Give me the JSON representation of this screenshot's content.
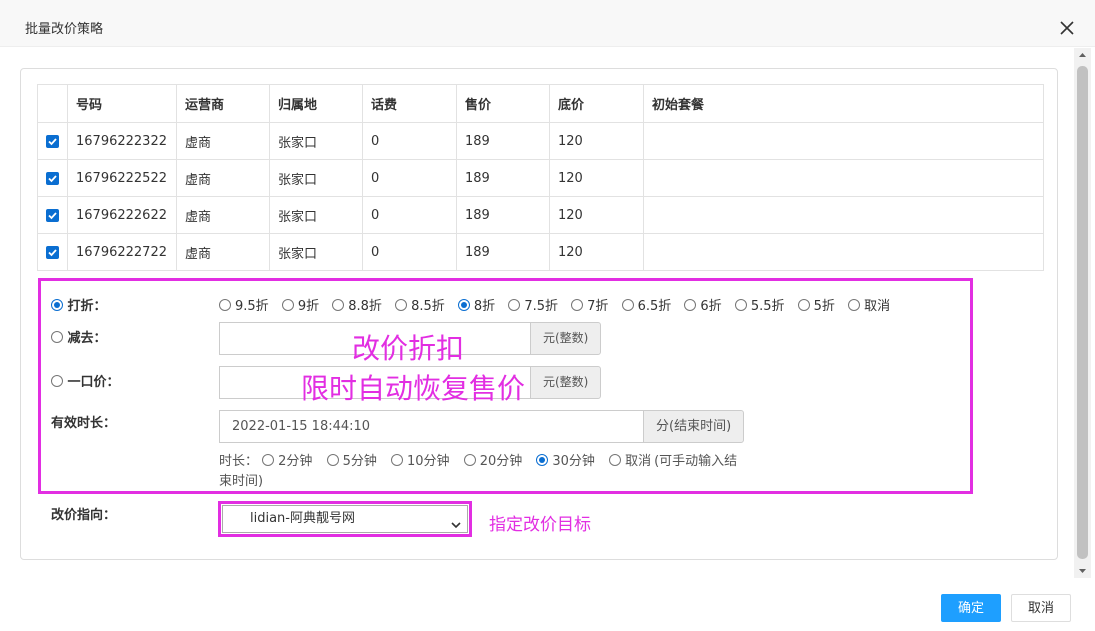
{
  "dialog": {
    "title": "批量改价策略"
  },
  "table": {
    "headers": [
      "号码",
      "运营商",
      "归属地",
      "话费",
      "售价",
      "底价",
      "初始套餐"
    ],
    "rows": [
      {
        "checked": true,
        "cells": [
          "16796222322",
          "虚商",
          "张家口",
          "0",
          "189",
          "120",
          ""
        ]
      },
      {
        "checked": true,
        "cells": [
          "16796222522",
          "虚商",
          "张家口",
          "0",
          "189",
          "120",
          ""
        ]
      },
      {
        "checked": true,
        "cells": [
          "16796222622",
          "虚商",
          "张家口",
          "0",
          "189",
          "120",
          ""
        ]
      },
      {
        "checked": true,
        "cells": [
          "16796222722",
          "虚商",
          "张家口",
          "0",
          "189",
          "120",
          ""
        ]
      }
    ]
  },
  "strategy": {
    "discount_label": "打折：",
    "discount_options": [
      "9.5折",
      "9折",
      "8.8折",
      "8.5折",
      "8折",
      "7.5折",
      "7折",
      "6.5折",
      "6折",
      "5.5折",
      "5折",
      "取消"
    ],
    "discount_selected": "8折",
    "subtract_label": "减去：",
    "subtract_value": "",
    "subtract_unit": "元(整数)",
    "fixed_label": "一口价：",
    "fixed_value": "",
    "fixed_unit": "元(整数)",
    "validity_label": "有效时长：",
    "validity_value": "2022-01-15 18:44:10",
    "validity_unit": "分(结束时间)",
    "duration_prefix": "时长：",
    "duration_options": [
      "2分钟",
      "5分钟",
      "10分钟",
      "20分钟",
      "30分钟",
      "取消"
    ],
    "duration_selected": "30分钟",
    "duration_note": "(可手动输入结束时间)"
  },
  "target": {
    "label": "改价指向：",
    "selected": "lidian-阿典靓号网"
  },
  "annotations": {
    "discount_note": "改价折扣",
    "restore_note": "限时自动恢复售价",
    "target_note": "指定改价目标"
  },
  "buttons": {
    "ok": "确定",
    "cancel": "取消"
  },
  "colors": {
    "primary": "#1e9fff",
    "checkbox": "#0a6ed1",
    "annotation": "#e22ee2"
  }
}
